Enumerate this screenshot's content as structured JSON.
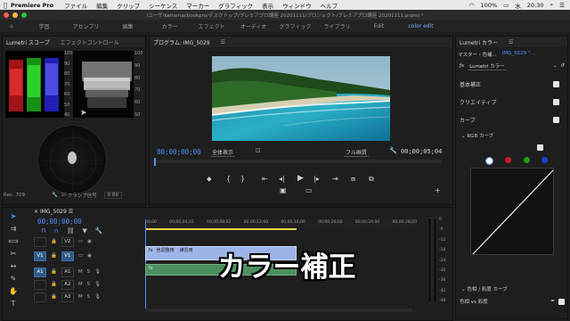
{
  "menubar": {
    "app_name": "Premiere Pro",
    "items": [
      "ファイル",
      "編集",
      "クリップ",
      "シーケンス",
      "マーカー",
      "グラフィック",
      "表示",
      "ウィンドウ",
      "ヘルプ"
    ],
    "battery": "100%",
    "day": "水",
    "clock": "20:30"
  },
  "titlebar": {
    "title": "/ユーザ/keitamacbookpro/デスクトップ/プレミアプロ講座 20201111/プロジェクト/プレミアプロ講座 20201111.prproj *"
  },
  "workspaces": {
    "tabs": [
      "学習",
      "アセンブリ",
      "編集",
      "カラー",
      "エフェクト",
      "オーディオ",
      "グラフィック",
      "ライブラリ",
      "Edit",
      "color edit"
    ],
    "active": "color edit"
  },
  "scopes": {
    "tab1": "Lumetri スコープ",
    "tab2": "エフェクトコントロール",
    "left_ticks": [
      "100",
      "90",
      "80",
      "70",
      "60",
      "50",
      "40"
    ],
    "right_ticks": [
      "100",
      "90",
      "80",
      "70",
      "60",
      "50"
    ],
    "footer_left": "Rec. 709",
    "footer_clamp": "クランプ信号",
    "footer_bits": "8 Bit"
  },
  "program": {
    "title": "プログラム: IMG_5029",
    "timecode_in": "00;00;00;00",
    "fit": "全体表示",
    "quality": "フル画質",
    "timecode_out": "00;00;05;04"
  },
  "timeline": {
    "sequence_name": "IMG_5029",
    "timecode": "00;00;00;00",
    "ruler": [
      "00;00",
      "00;00;04;02",
      "00;00;08;02",
      "00;00;12;00",
      "00;00;16;00",
      "00;00;20;00",
      "00;00;24;00",
      "00;00;28;00"
    ],
    "tracks": [
      {
        "id": "V2",
        "label": "V2",
        "tag": ""
      },
      {
        "id": "V1",
        "label": "V1",
        "tag": "V1"
      },
      {
        "id": "A1",
        "label": "A1",
        "tag": "A1"
      },
      {
        "id": "A2",
        "label": "A2",
        "tag": ""
      },
      {
        "id": "A3",
        "label": "A3",
        "tag": ""
      }
    ],
    "clip_label": "色調整用",
    "clip_label2": "練習用",
    "fx_label": "fx",
    "audio_meter_ticks": [
      "0",
      "-6",
      "-12",
      "-18",
      "-24",
      "-30",
      "-36",
      "-42",
      "-48"
    ],
    "caption": "カラー補正"
  },
  "lumetri": {
    "tab": "Lumetri カラー",
    "master": "マスター・色補...",
    "clip": "IMG_5029 *...",
    "fx_name": "Lumetri カラー",
    "sections": [
      "基本補正",
      "クリエイティブ",
      "カーブ"
    ],
    "rgb_curve": "RGB カーブ",
    "hue_sat": "色相 / 彩度 カーブ",
    "hue_vs_sat": "色相 vs 彩度",
    "curve_colors": [
      "#ffffff",
      "#c91f1f",
      "#1fa11f",
      "#1f3fc9"
    ]
  }
}
